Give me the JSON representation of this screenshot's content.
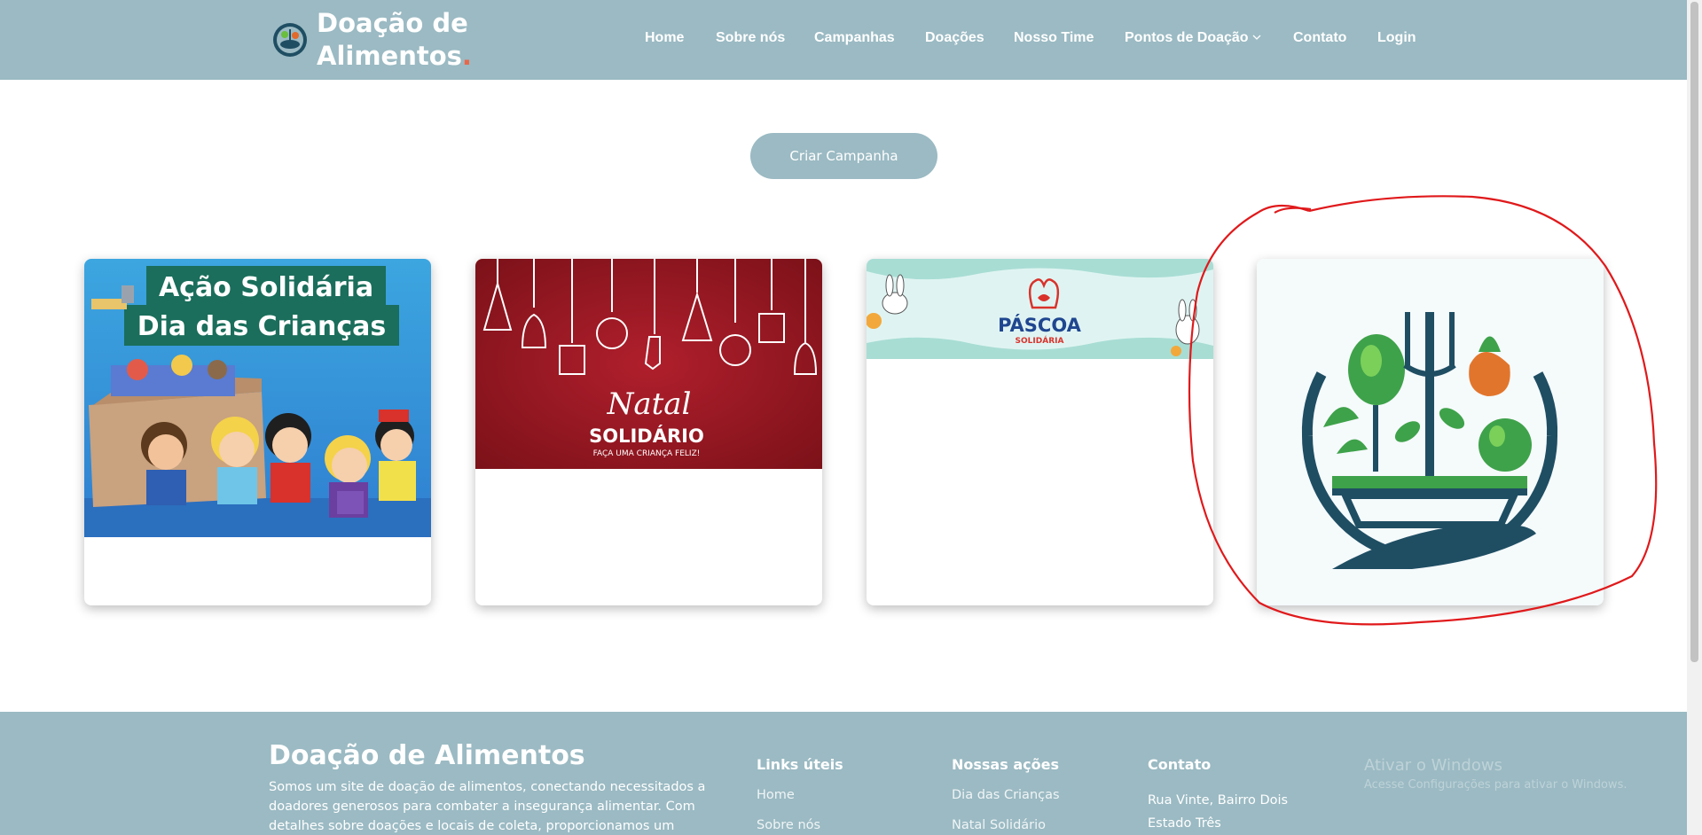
{
  "header": {
    "logo_line1": "Doação de",
    "logo_line2": "Alimentos",
    "logo_dot": ".",
    "nav": [
      {
        "label": "Home"
      },
      {
        "label": "Sobre nós"
      },
      {
        "label": "Campanhas"
      },
      {
        "label": "Doações"
      },
      {
        "label": "Nosso Time"
      },
      {
        "label": "Pontos de Doação"
      },
      {
        "label": "Contato"
      },
      {
        "label": "Login"
      }
    ]
  },
  "main": {
    "create_button": "Criar Campanha",
    "cards": [
      {
        "banner_line1": "Ação Solidária",
        "banner_line2": "Dia das Crianças"
      },
      {
        "script": "Natal",
        "title": "SOLIDÁRIO",
        "subtitle": "FAÇA UMA CRIANÇA FELIZ!"
      },
      {
        "title": "PÁSCOA",
        "subtitle": "SOLIDÁRIA"
      },
      {}
    ]
  },
  "footer": {
    "title": "Doação de Alimentos",
    "description": "Somos um site de doação de alimentos, conectando necessitados a doadores generosos para combater a insegurança alimentar. Com detalhes sobre doações e locais de coleta, proporcionamos um ambiente",
    "links_title": "Links úteis",
    "links": [
      "Home",
      "Sobre nós"
    ],
    "actions_title": "Nossas ações",
    "actions": [
      "Dia das Crianças",
      "Natal Solidário"
    ],
    "contact_title": "Contato",
    "contact": [
      "Rua Vinte, Bairro Dois",
      "Estado Três"
    ]
  },
  "watermark": {
    "line1": "Ativar o Windows",
    "line2": "Acesse Configurações para ativar o Windows."
  },
  "colors": {
    "header_bg": "#9bbac3",
    "accent_dot": "#e8674a",
    "annotation": "#e0191b"
  }
}
